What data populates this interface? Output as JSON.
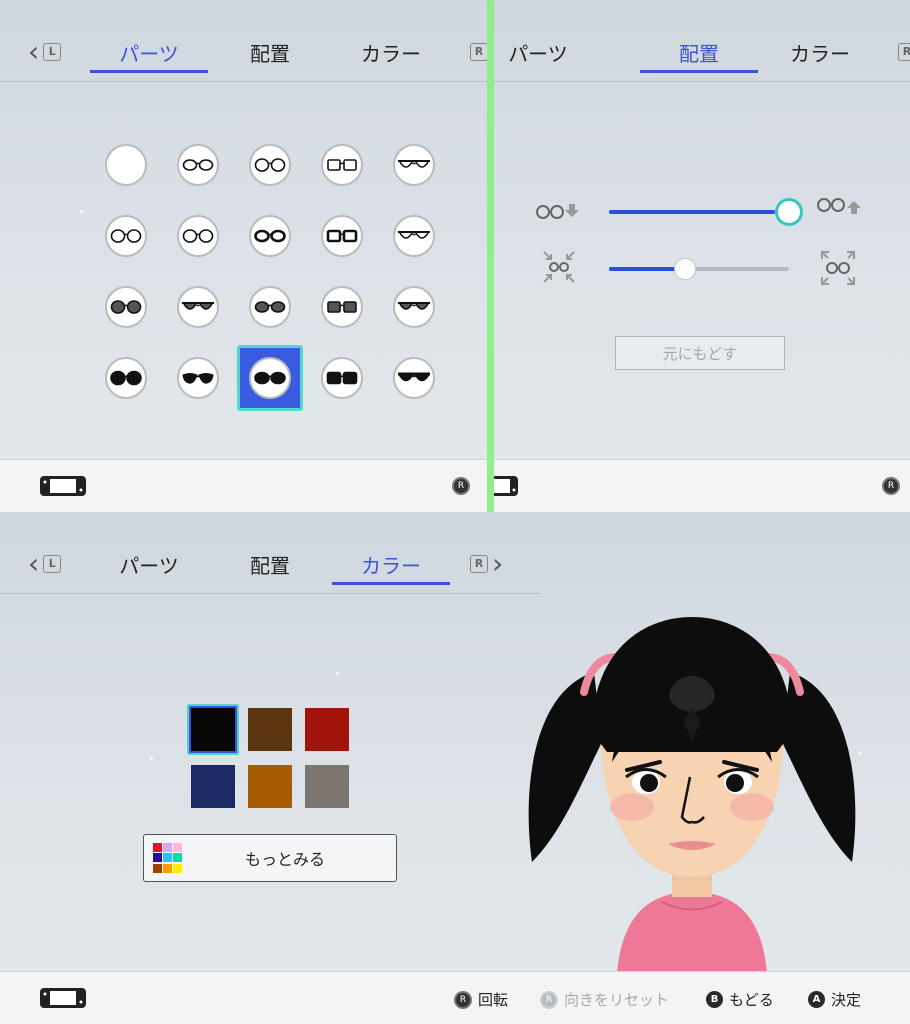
{
  "tabs": {
    "parts": "パーツ",
    "placement": "配置",
    "color": "カラー"
  },
  "nav": {
    "left_badge": "L",
    "right_badge": "R"
  },
  "panel_parts": {
    "active_tab": "parts",
    "glasses": [
      {
        "icon": "no-glasses-icon",
        "shape": "none"
      },
      {
        "icon": "oval-glasses-icon",
        "shape": "oval"
      },
      {
        "icon": "rounded-glasses-icon",
        "shape": "rounded"
      },
      {
        "icon": "square-glasses-icon",
        "shape": "square"
      },
      {
        "icon": "half-rim-glasses-icon",
        "shape": "halfrim"
      },
      {
        "icon": "round-glasses-icon",
        "shape": "round"
      },
      {
        "icon": "thin-round-glasses-icon",
        "shape": "thinround"
      },
      {
        "icon": "thick-oval-glasses-icon",
        "shape": "thickoval"
      },
      {
        "icon": "thick-square-glasses-icon",
        "shape": "thicksquare"
      },
      {
        "icon": "top-rim-glasses-icon",
        "shape": "toprim"
      },
      {
        "icon": "tinted-round-glasses-icon",
        "shape": "tintround"
      },
      {
        "icon": "tinted-aviator-glasses-icon",
        "shape": "tintaviator"
      },
      {
        "icon": "tinted-oval-glasses-icon",
        "shape": "tintoval"
      },
      {
        "icon": "tinted-square-glasses-icon",
        "shape": "tintsquare"
      },
      {
        "icon": "tinted-browline-glasses-icon",
        "shape": "tintbrow"
      },
      {
        "icon": "round-sunglasses-icon",
        "shape": "sunround"
      },
      {
        "icon": "wrap-sunglasses-icon",
        "shape": "sunwrap"
      },
      {
        "icon": "oval-sunglasses-icon",
        "shape": "sunoval"
      },
      {
        "icon": "square-sunglasses-icon",
        "shape": "sunsquare"
      },
      {
        "icon": "aviator-sunglasses-icon",
        "shape": "sunaviator"
      }
    ],
    "selected_index": 17
  },
  "panel_placement": {
    "active_tab": "placement",
    "size_slider_value": 1.0,
    "position_slider_value": 0.42,
    "reset_label": "元にもどす"
  },
  "panel_color": {
    "active_tab": "color",
    "swatches": [
      "#070707",
      "#5a3510",
      "#a0140c",
      "#1b2a63",
      "#a85c00",
      "#7d7670"
    ],
    "selected_index": 0,
    "more_label": "もっとみる",
    "more_icon_colors": [
      "#e8102a",
      "#d9a6ff",
      "#ffb5e0",
      "#2a0ba0",
      "#1ec8ff",
      "#10d8a8",
      "#a04000",
      "#ff9a00",
      "#ffee00"
    ]
  },
  "footer": {
    "rotate_label": "回転",
    "reset_view_label": "向きをリセット",
    "back_label": "もどる",
    "confirm_label": "決定",
    "back_button": "B",
    "confirm_button": "A",
    "stick_badge": "R"
  },
  "colors": {
    "accent": "#3a53d8",
    "highlight": "#4fd7cf",
    "divider": "#8ef08a"
  }
}
